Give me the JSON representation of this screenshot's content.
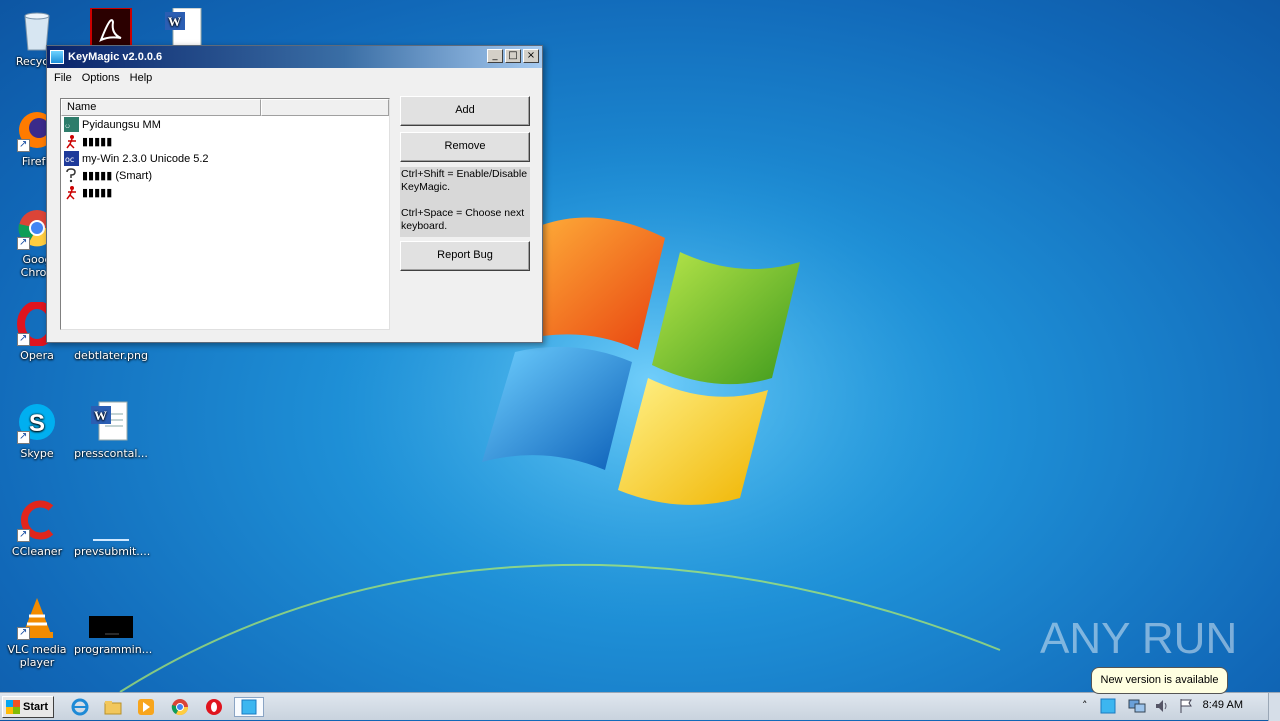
{
  "window": {
    "title": "KeyMagic v2.0.0.6",
    "controls": {
      "minimize": "_",
      "maximize": "□",
      "close": "×"
    },
    "menu": [
      "File",
      "Options",
      "Help"
    ],
    "list": {
      "columns": [
        "Name",
        ""
      ],
      "rows": [
        {
          "label": "Pyidaungsu MM",
          "icon": "pyidaungsu-icon"
        },
        {
          "label": "▮▮▮▮▮",
          "icon": "figure-icon"
        },
        {
          "label": "my-Win 2.3.0 Unicode 5.2",
          "icon": "mywin-icon"
        },
        {
          "label": "▮▮▮▮▮ (Smart)",
          "icon": "smart-icon"
        },
        {
          "label": "▮▮▮▮▮",
          "icon": "figure-icon"
        }
      ]
    },
    "buttons": {
      "add": "Add",
      "remove": "Remove",
      "report_bug": "Report Bug"
    },
    "hint": {
      "line1": "Ctrl+Shift = Enable/Disable KeyMagic.",
      "line2": "Ctrl+Space = Choose next keyboard."
    }
  },
  "desktop_icons": [
    {
      "label": "Recycle",
      "icon": "recycle-bin-icon"
    },
    {
      "label": "Firefo",
      "icon": "firefox-icon"
    },
    {
      "label": "Goog Chron",
      "icon": "chrome-icon"
    },
    {
      "label": "Opera",
      "icon": "opera-icon"
    },
    {
      "label": "debtlater.png",
      "icon": "image-file-icon"
    },
    {
      "label": "Skype",
      "icon": "skype-icon"
    },
    {
      "label": "presscontal...",
      "icon": "word-doc-icon"
    },
    {
      "label": "CCleaner",
      "icon": "ccleaner-icon"
    },
    {
      "label": "prevsubmit....",
      "icon": "file-icon"
    },
    {
      "label": "VLC media player",
      "icon": "vlc-icon"
    },
    {
      "label": "programmin...",
      "icon": "black-file-icon"
    }
  ],
  "taskbar": {
    "start_label": "Start",
    "clock": "8:49 AM",
    "balloon": "New version is available",
    "pinned": [
      "ie-icon",
      "explorer-icon",
      "media-player-icon",
      "chrome-icon",
      "opera-icon",
      "keymagic-icon"
    ]
  },
  "watermark": "ANY RUN",
  "colors": {
    "desktop": "#1e8fd6",
    "titlebar": "#0a246a",
    "balloon": "#ffffe1"
  }
}
